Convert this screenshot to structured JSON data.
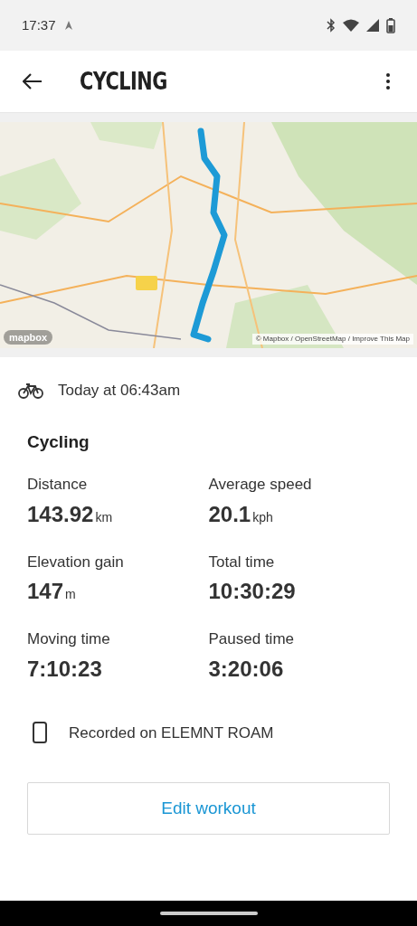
{
  "status_bar": {
    "time": "17:37"
  },
  "header": {
    "title": "CYCLING"
  },
  "map": {
    "kind": "picture",
    "logo": "mapbox",
    "attribution": "© Mapbox / OpenStreetMap / Improve This Map"
  },
  "activity": {
    "date": "Today at 06:43am",
    "name": "Cycling"
  },
  "stats": [
    {
      "label": "Distance",
      "value": "143.92",
      "unit": "km"
    },
    {
      "label": "Average speed",
      "value": "20.1",
      "unit": "kph"
    },
    {
      "label": "Elevation gain",
      "value": "147",
      "unit": "m"
    },
    {
      "label": "Total time",
      "value": "10:30:29"
    },
    {
      "label": "Moving time",
      "value": "7:10:23"
    },
    {
      "label": "Paused time",
      "value": "3:20:06"
    }
  ],
  "device": {
    "text": "Recorded on ELEMNT ROAM"
  },
  "button": {
    "label": "Edit workout"
  }
}
